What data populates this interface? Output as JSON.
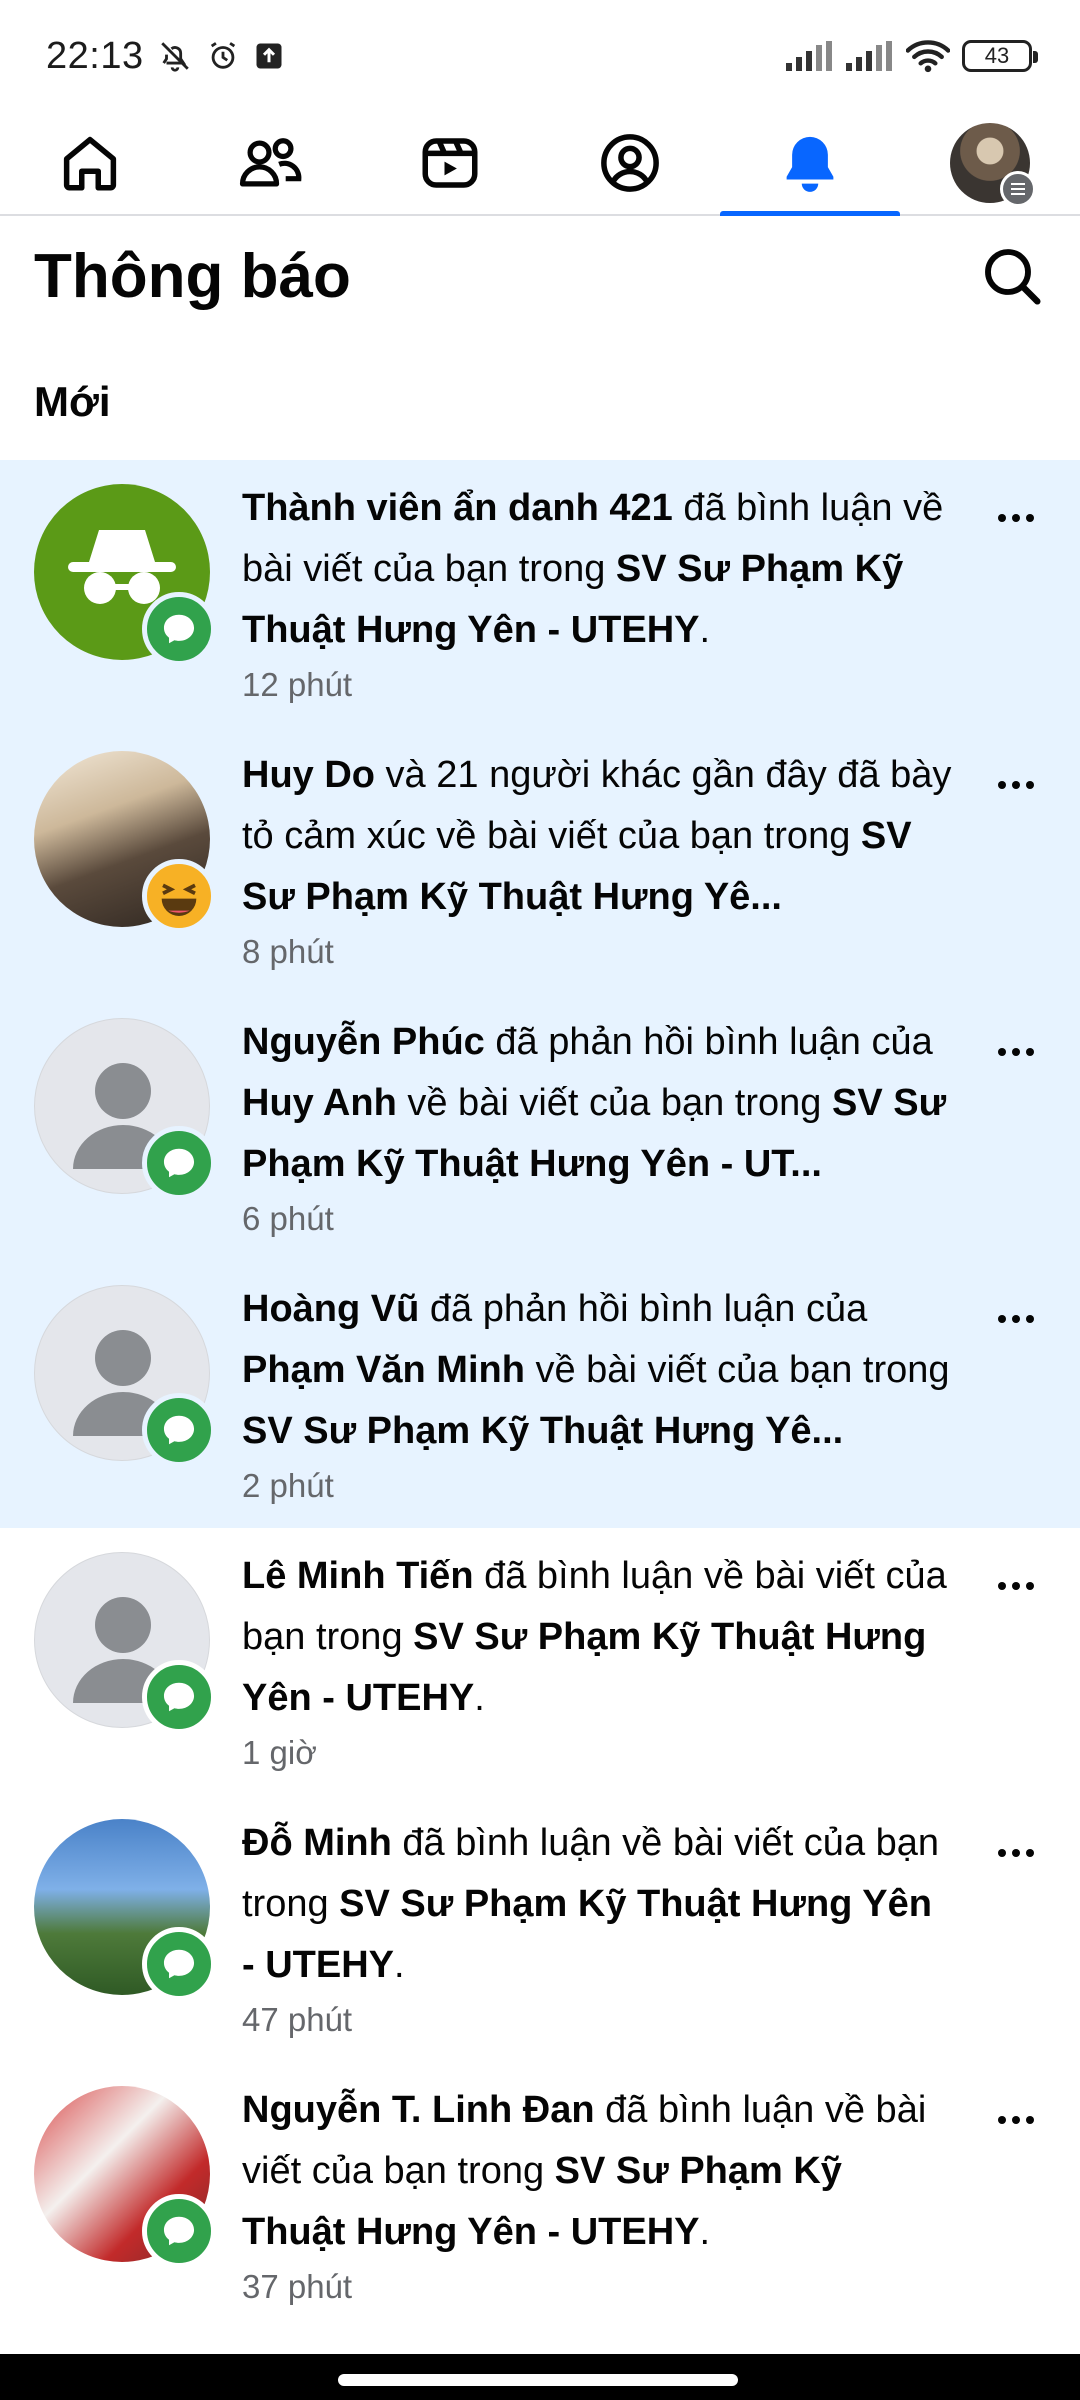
{
  "status_bar": {
    "time": "22:13",
    "battery": "43"
  },
  "nav": {
    "tabs": [
      {
        "id": "home",
        "icon": "home-icon"
      },
      {
        "id": "friends",
        "icon": "friends-icon"
      },
      {
        "id": "video",
        "icon": "video-icon"
      },
      {
        "id": "profile",
        "icon": "profile-icon"
      },
      {
        "id": "notifications",
        "icon": "bell-icon",
        "active": true
      },
      {
        "id": "menu",
        "icon": "avatar-menu"
      }
    ],
    "accent_color": "#0866ff"
  },
  "header": {
    "title": "Thông báo",
    "search_icon": "search-icon"
  },
  "section": {
    "label": "Mới"
  },
  "notifications": [
    {
      "unread": true,
      "badge": "comment",
      "segments": [
        [
          "Thành viên ẩn danh 421",
          true
        ],
        [
          " đã bình luận về bài viết của bạn trong ",
          false
        ],
        [
          "SV Sư Phạm Kỹ Thuật Hưng Yên - UTEHY",
          true
        ],
        [
          ".",
          false
        ]
      ],
      "time": "12 phút"
    },
    {
      "unread": true,
      "badge": "haha",
      "segments": [
        [
          "Huy Do",
          true
        ],
        [
          " và 21 người khác gần đây đã bày tỏ cảm xúc về bài viết của bạn trong ",
          false
        ],
        [
          "SV Sư Phạm Kỹ Thuật Hưng Yê...",
          true
        ]
      ],
      "time": "8 phút"
    },
    {
      "unread": true,
      "badge": "comment",
      "segments": [
        [
          "Nguyễn Phúc",
          true
        ],
        [
          " đã phản hồi bình luận của ",
          false
        ],
        [
          "Huy Anh",
          true
        ],
        [
          " về bài viết của bạn trong ",
          false
        ],
        [
          "SV Sư Phạm Kỹ Thuật Hưng Yên - UT...",
          true
        ]
      ],
      "time": "6 phút"
    },
    {
      "unread": true,
      "badge": "comment",
      "segments": [
        [
          "Hoàng Vũ",
          true
        ],
        [
          " đã phản hồi bình luận của ",
          false
        ],
        [
          "Phạm Văn Minh",
          true
        ],
        [
          " về bài viết của bạn trong ",
          false
        ],
        [
          "SV Sư Phạm Kỹ Thuật Hưng Yê...",
          true
        ]
      ],
      "time": "2 phút"
    },
    {
      "unread": false,
      "badge": "comment",
      "segments": [
        [
          "Lê Minh Tiến",
          true
        ],
        [
          " đã bình luận về bài viết của bạn trong ",
          false
        ],
        [
          "SV Sư Phạm Kỹ Thuật Hưng Yên - UTEHY",
          true
        ],
        [
          ".",
          false
        ]
      ],
      "time": "1 giờ"
    },
    {
      "unread": false,
      "badge": "comment",
      "segments": [
        [
          "Đỗ Minh",
          true
        ],
        [
          " đã bình luận về bài viết của bạn trong ",
          false
        ],
        [
          "SV Sư Phạm Kỹ Thuật Hưng Yên - UTEHY",
          true
        ],
        [
          ".",
          false
        ]
      ],
      "time": "47 phút"
    },
    {
      "unread": false,
      "badge": "comment",
      "segments": [
        [
          "Nguyễn T. Linh Đan",
          true
        ],
        [
          " đã bình luận về bài viết của bạn trong ",
          false
        ],
        [
          "SV Sư Phạm Kỹ Thuật Hưng Yên - UTEHY",
          true
        ],
        [
          ".",
          false
        ]
      ],
      "time": "37 phút"
    }
  ],
  "colors": {
    "unread_bg": "#e7f3ff",
    "comment_badge": "#31a24c",
    "haha_badge": "#f7b125"
  }
}
